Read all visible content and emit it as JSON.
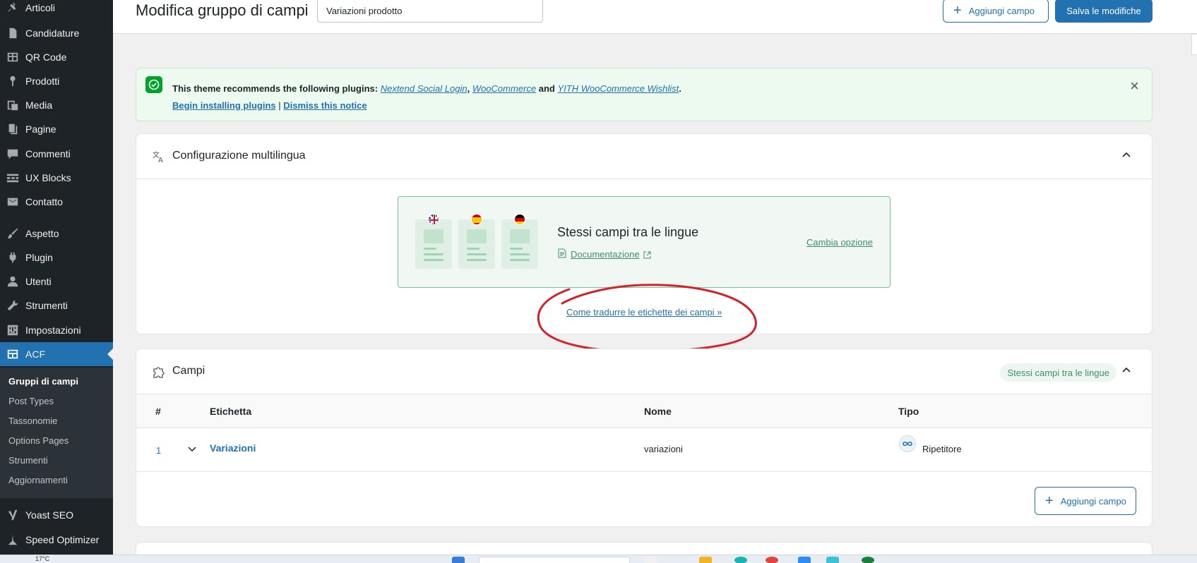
{
  "sidebar": {
    "items": [
      {
        "label": "Articoli",
        "icon": "pin-icon"
      },
      {
        "label": "Candidature",
        "icon": "document-icon"
      },
      {
        "label": "QR Code",
        "icon": "table-icon"
      },
      {
        "label": "Prodotti",
        "icon": "location-pin-icon"
      },
      {
        "label": "Media",
        "icon": "media-icon"
      },
      {
        "label": "Pagine",
        "icon": "pages-icon"
      },
      {
        "label": "Commenti",
        "icon": "comment-icon"
      },
      {
        "label": "UX Blocks",
        "icon": "blocks-icon"
      },
      {
        "label": "Contatto",
        "icon": "mail-icon"
      },
      {
        "label": "Aspetto",
        "icon": "brush-icon"
      },
      {
        "label": "Plugin",
        "icon": "plugin-icon"
      },
      {
        "label": "Utenti",
        "icon": "user-icon"
      },
      {
        "label": "Strumenti",
        "icon": "wrench-icon"
      },
      {
        "label": "Impostazioni",
        "icon": "settings-icon"
      },
      {
        "label": "ACF",
        "icon": "acf-icon"
      },
      {
        "label": "Yoast SEO",
        "icon": "yoast-icon"
      },
      {
        "label": "Speed Optimizer",
        "icon": "speed-icon"
      }
    ],
    "submenu": [
      "Gruppi di campi",
      "Post Types",
      "Tassonomie",
      "Options Pages",
      "Strumenti",
      "Aggiornamenti"
    ]
  },
  "header": {
    "title": "Modifica gruppo di campi",
    "group_name": "Variazioni prodotto",
    "add_field_label": "Aggiungi campo",
    "save_label": "Salva le modifiche"
  },
  "notice": {
    "prefix": "This theme recommends the following plugins:",
    "plugin1": "Nextend Social Login",
    "sep1": ",",
    "plugin2": "WooCommerce",
    "and": "and",
    "plugin3": "YITH WooCommerce Wishlist",
    "suffix": ".",
    "begin_link": "Begin installing plugins",
    "divider": "|",
    "dismiss_link": "Dismiss this notice"
  },
  "multilingual": {
    "title": "Configurazione multilingua",
    "card_title": "Stessi campi tra le lingue",
    "doc_link": "Documentazione",
    "change_link": "Cambia opzione",
    "how_link": "Come tradurre le etichette dei campi »"
  },
  "fields": {
    "title": "Campi",
    "badge": "Stessi campi tra le lingue",
    "columns": [
      "#",
      "Etichetta",
      "Nome",
      "Tipo"
    ],
    "rows": [
      {
        "num": "1",
        "label": "Variazioni",
        "name": "variazioni",
        "type": "Ripetitore"
      }
    ],
    "add_field_label": "Aggiungi campo"
  },
  "taskbar": {
    "temperature": "17°C"
  },
  "colors": {
    "wp_blue": "#2271b1",
    "sidebar_bg": "#1d2327",
    "annotation_red": "#d2232a",
    "success_green": "#00a32a"
  }
}
